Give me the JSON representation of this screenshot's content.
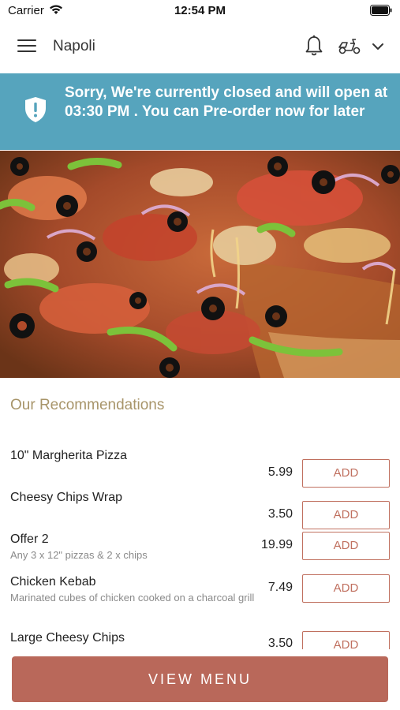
{
  "status_bar": {
    "carrier": "Carrier",
    "time": "12:54 PM"
  },
  "header": {
    "title": "Napoli",
    "icons": [
      "menu-icon",
      "bell-icon",
      "scooter-icon",
      "chevron-down-icon"
    ]
  },
  "closed_banner": {
    "message": "Sorry, We're currently closed and will open at 03:30 PM . You can Pre-order now for later",
    "icon": "shield-icon",
    "color": "#56a4bd"
  },
  "hero": {
    "icon": "pizza-photo"
  },
  "recommendations": {
    "title": "Our Recommendations",
    "items": [
      {
        "name": "10\" Margherita Pizza",
        "description": "",
        "price": "5.99",
        "button": "ADD"
      },
      {
        "name": "Cheesy Chips Wrap",
        "description": "",
        "price": "3.50",
        "button": "ADD"
      },
      {
        "name": "Offer 2",
        "description": "Any 3 x 12\" pizzas & 2 x chips",
        "price": "19.99",
        "button": "ADD"
      },
      {
        "name": "Chicken Kebab",
        "description": "Marinated cubes of chicken cooked on a charcoal grill",
        "price": "7.49",
        "button": "ADD"
      },
      {
        "name": "Large Cheesy Chips",
        "description": "",
        "price": "3.50",
        "button": "ADD"
      }
    ]
  },
  "footer": {
    "view_menu_label": "VIEW MENU"
  },
  "colors": {
    "accent": "#b9685a",
    "banner": "#56a4bd",
    "section_title": "#a8956a"
  }
}
